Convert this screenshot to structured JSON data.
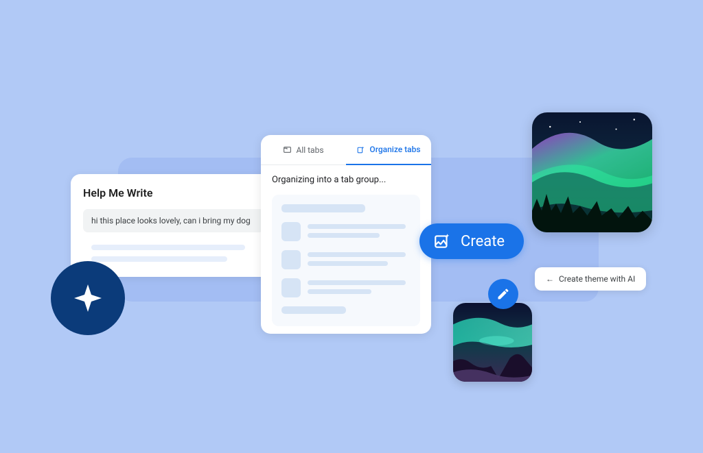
{
  "help_me_write": {
    "title": "Help Me Write",
    "input_text": "hi this place looks lovely, can i bring my dog"
  },
  "organize": {
    "tab_all": "All tabs",
    "tab_org": "Organize tabs",
    "status": "Organizing into a tab group..."
  },
  "create": {
    "label": "Create"
  },
  "theme_chip": {
    "label": "Create theme with AI",
    "arrow": "←"
  }
}
